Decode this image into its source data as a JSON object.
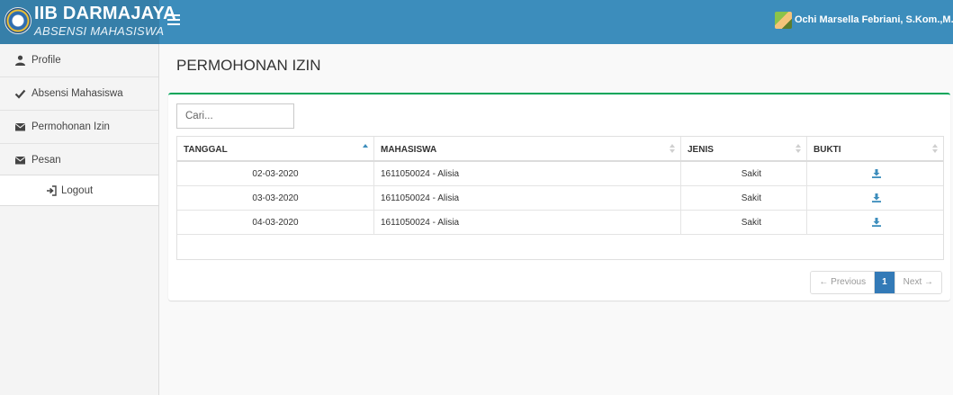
{
  "header": {
    "brand_title": "IIB DARMAJAYA",
    "brand_subtitle": "ABSENSI MAHASISWA",
    "user_name": "Ochi Marsella Febriani, S.Kom.,M.T.I",
    "colors": {
      "header": "#3c8dbc",
      "brand": "#367fa9"
    }
  },
  "sidebar": {
    "items": [
      {
        "label": "Profile",
        "icon": "user-icon"
      },
      {
        "label": "Absensi Mahasiswa",
        "icon": "check-icon"
      },
      {
        "label": "Permohonan Izin",
        "icon": "envelope-icon"
      },
      {
        "label": "Pesan",
        "icon": "envelope-icon"
      }
    ],
    "logout_label": "Logout"
  },
  "page": {
    "title": "PERMOHONAN IZIN"
  },
  "search": {
    "placeholder": "Cari..."
  },
  "table": {
    "columns": [
      "TANGGAL",
      "MAHASISWA",
      "JENIS",
      "BUKTI"
    ],
    "rows": [
      {
        "tanggal": "02-03-2020",
        "mahasiswa": "1611050024 - Alisia",
        "jenis": "Sakit",
        "bukti": "download-icon"
      },
      {
        "tanggal": "03-03-2020",
        "mahasiswa": "1611050024 - Alisia",
        "jenis": "Sakit",
        "bukti": "download-icon"
      },
      {
        "tanggal": "04-03-2020",
        "mahasiswa": "1611050024 - Alisia",
        "jenis": "Sakit",
        "bukti": "download-icon"
      }
    ]
  },
  "pagination": {
    "previous": "← Previous",
    "current": "1",
    "next": "Next →"
  },
  "accent": {
    "box_border": "#00a65a",
    "active_page": "#337ab7"
  }
}
